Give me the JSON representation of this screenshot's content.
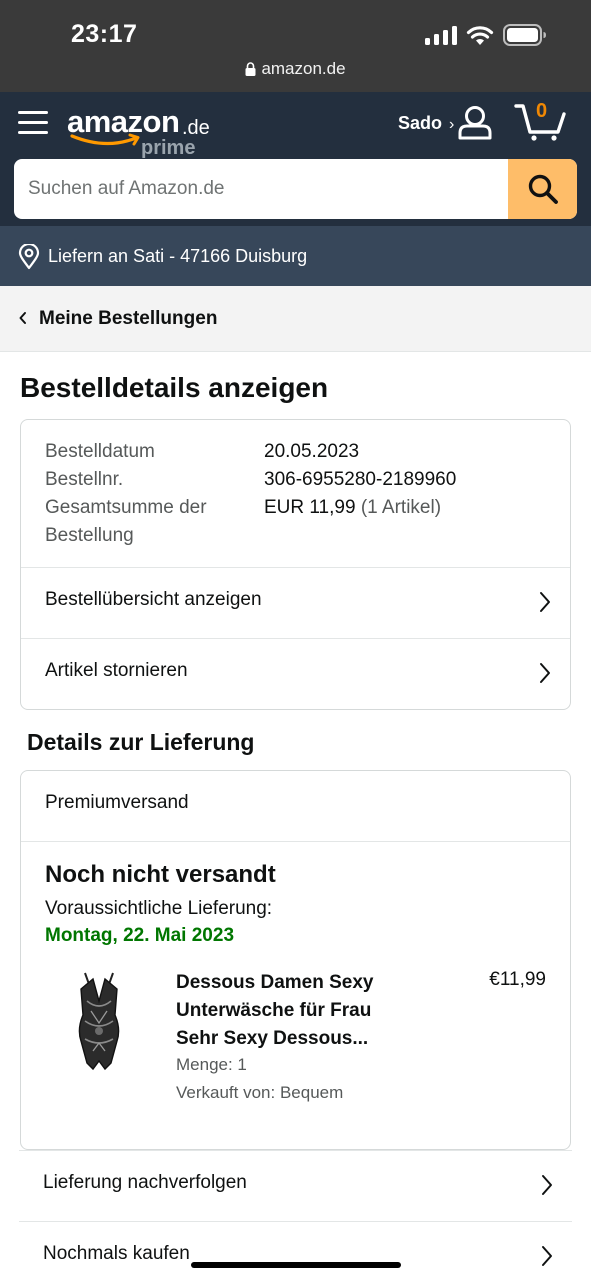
{
  "status_bar": {
    "time": "23:17",
    "url": "amazon.de"
  },
  "header": {
    "logo_word": "amazon",
    "logo_tld": ".de",
    "logo_sub": "prime",
    "account_name": "Sado",
    "account_chevron": "›",
    "cart_count": "0",
    "accent_color": "#febd69",
    "nav_color": "#232f3e"
  },
  "search": {
    "placeholder": "Suchen auf Amazon.de",
    "value": ""
  },
  "delivery_bar": {
    "text": "Liefern an Sati - 47166 Duisburg"
  },
  "breadcrumb": {
    "label": "Meine Bestellungen"
  },
  "page_title": "Bestelldetails anzeigen",
  "order": {
    "date_label": "Bestelldatum",
    "date_value": "20.05.2023",
    "number_label": "Bestellnr.",
    "number_value": "306-6955280-2189960",
    "total_label_line1": "Gesamtsumme der",
    "total_label_line2": "Bestellung",
    "total_value": "EUR 11,99",
    "total_items": "(1 Artikel)",
    "link_overview": "Bestellübersicht anzeigen",
    "link_cancel": "Artikel stornieren"
  },
  "delivery": {
    "section_title": "Details zur Lieferung",
    "shipping_type": "Premiumversand",
    "status": "Noch nicht versandt",
    "eta_label": "Voraussichtliche Lieferung:",
    "eta_date": "Montag, 22. Mai 2023",
    "product": {
      "title_line1": "Dessous Damen Sexy",
      "title_line2": "Unterwäsche für Frau",
      "title_line3": "Sehr Sexy Dessous...",
      "price": "€11,99",
      "quantity": "Menge: 1",
      "seller": "Verkauft von: Bequem"
    }
  },
  "actions": {
    "track": "Lieferung nachverfolgen",
    "buy_again": "Nochmals kaufen"
  }
}
